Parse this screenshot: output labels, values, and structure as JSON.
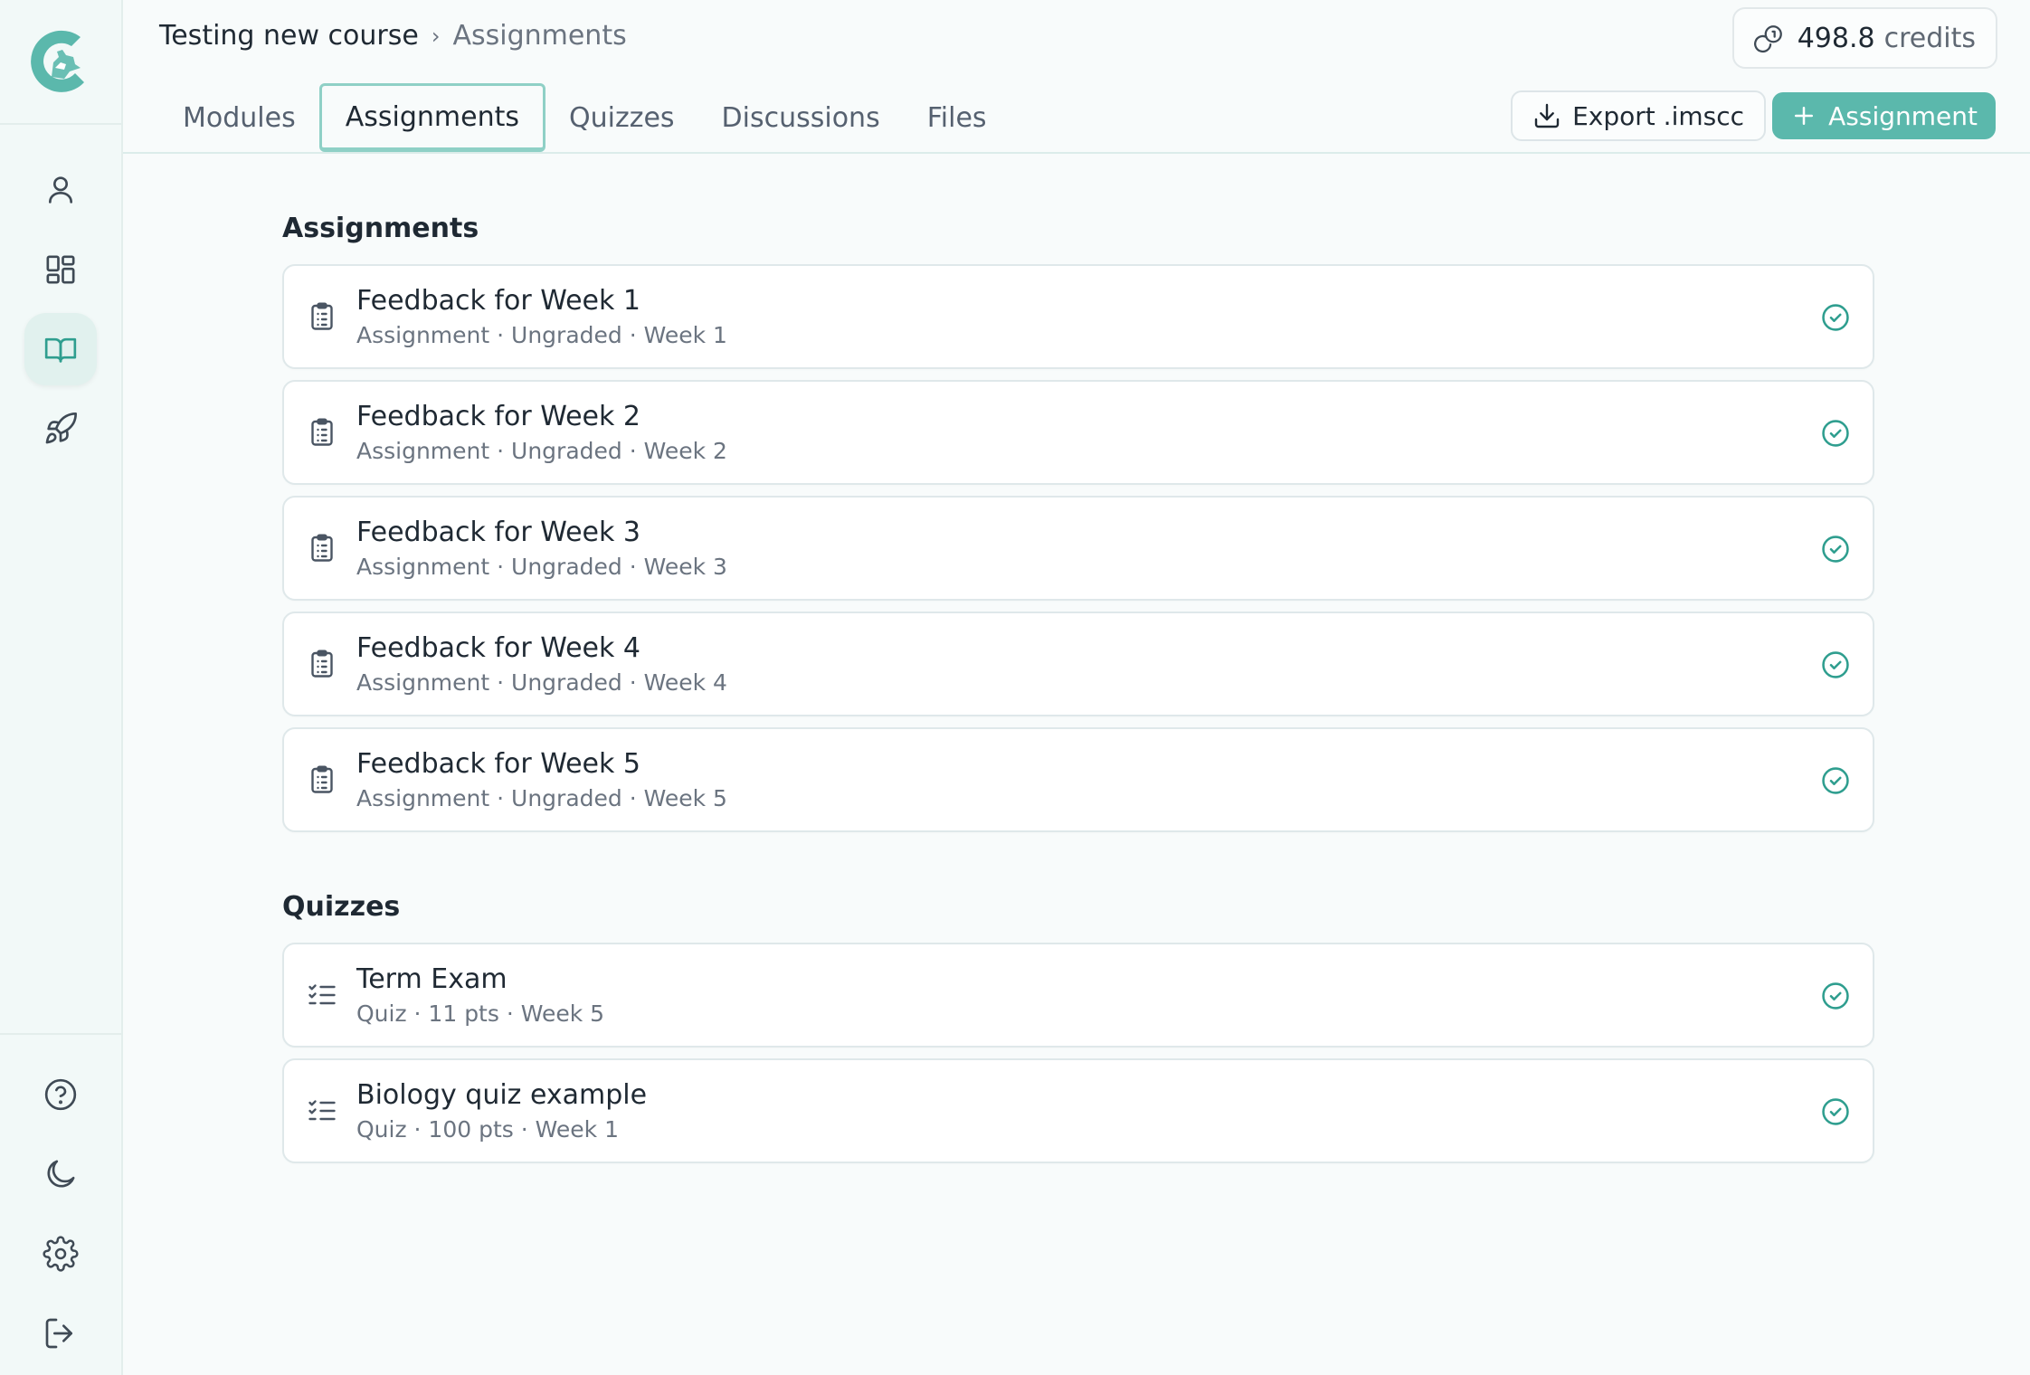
{
  "sidebar": {
    "nav": [
      {
        "icon": "user-icon",
        "active": false
      },
      {
        "icon": "dashboard-icon",
        "active": false
      },
      {
        "icon": "book-open-icon",
        "active": true
      },
      {
        "icon": "rocket-icon",
        "active": false
      }
    ],
    "footer": [
      {
        "icon": "help-circle-icon"
      },
      {
        "icon": "moon-icon"
      },
      {
        "icon": "gear-icon"
      },
      {
        "icon": "logout-icon"
      }
    ]
  },
  "header": {
    "breadcrumb": {
      "course": "Testing new course",
      "separator": "›",
      "current": "Assignments"
    },
    "credits": {
      "amount": "498.8",
      "unit": "credits",
      "icon": "coins-icon"
    },
    "tabs": [
      {
        "label": "Modules",
        "active": false
      },
      {
        "label": "Assignments",
        "active": true
      },
      {
        "label": "Quizzes",
        "active": false
      },
      {
        "label": "Discussions",
        "active": false
      },
      {
        "label": "Files",
        "active": false
      }
    ],
    "export_label": "Export .imscc",
    "add_label": "Assignment"
  },
  "assignments": {
    "title": "Assignments",
    "items": [
      {
        "title": "Feedback for Week 1",
        "meta": "Assignment · Ungraded · Week 1"
      },
      {
        "title": "Feedback for Week 2",
        "meta": "Assignment · Ungraded · Week 2"
      },
      {
        "title": "Feedback for Week 3",
        "meta": "Assignment · Ungraded · Week 3"
      },
      {
        "title": "Feedback for Week 4",
        "meta": "Assignment · Ungraded · Week 4"
      },
      {
        "title": "Feedback for Week 5",
        "meta": "Assignment · Ungraded · Week 5"
      }
    ]
  },
  "quizzes": {
    "title": "Quizzes",
    "items": [
      {
        "title": "Term Exam",
        "meta": "Quiz · 11 pts · Week 5"
      },
      {
        "title": "Biology quiz example",
        "meta": "Quiz · 100 pts · Week 1"
      }
    ]
  },
  "colors": {
    "accent": "#5bb8ac",
    "accent_dark": "#2f9e8f",
    "sidebar_bg": "#f2f9f8",
    "page_bg": "#f8fbfb"
  }
}
